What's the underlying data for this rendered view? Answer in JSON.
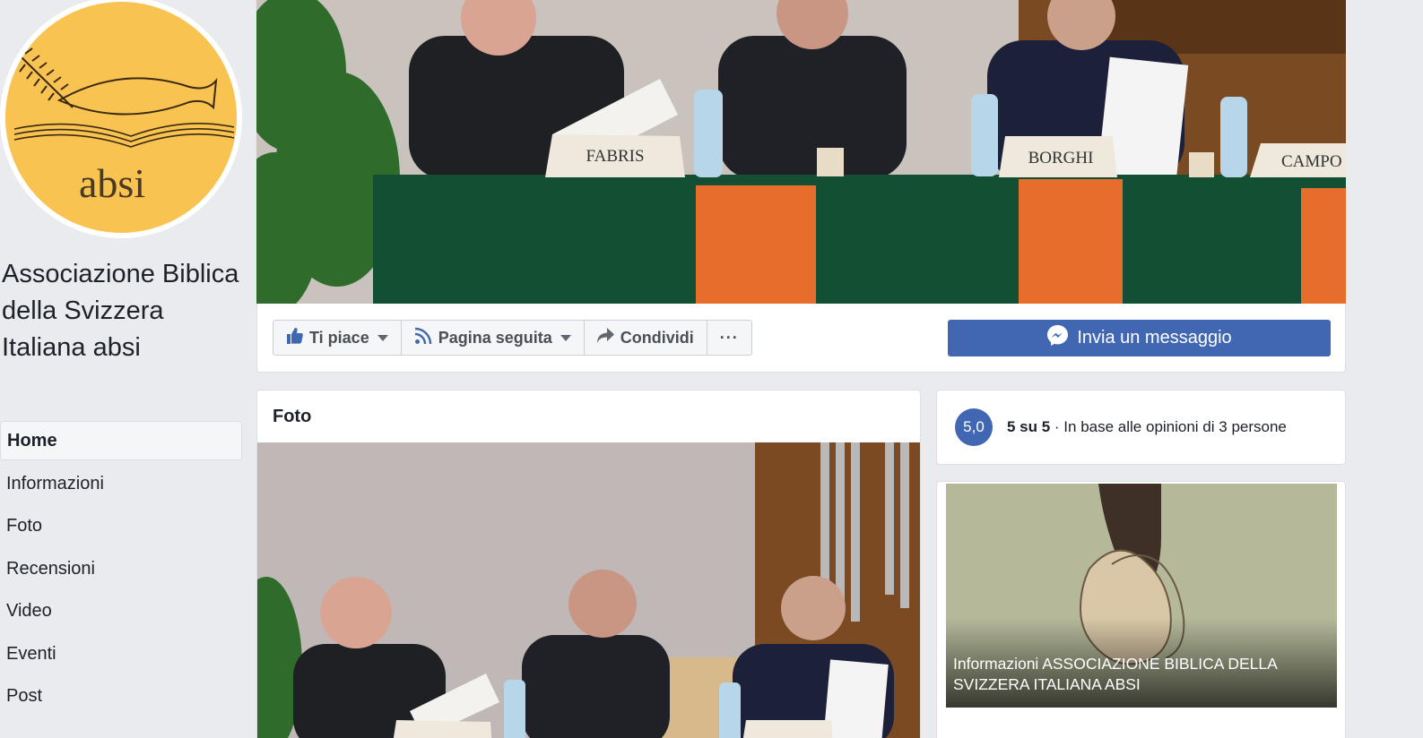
{
  "page": {
    "name": "Associazione Biblica della Svizzera Italiana absi",
    "logo_text": "absi"
  },
  "nav": {
    "items": [
      {
        "label": "Home",
        "active": true
      },
      {
        "label": "Informazioni"
      },
      {
        "label": "Foto"
      },
      {
        "label": "Recensioni"
      },
      {
        "label": "Video"
      },
      {
        "label": "Eventi"
      },
      {
        "label": "Post"
      }
    ]
  },
  "cover": {
    "nameplates": [
      "FABRIS",
      "BORGHI",
      "CAMPO"
    ]
  },
  "actions": {
    "like_label": "Ti piace",
    "follow_label": "Pagina seguita",
    "share_label": "Condividi",
    "more_label": "···",
    "message_label": "Invia un messaggio"
  },
  "photos": {
    "title": "Foto"
  },
  "rating": {
    "score": "5,0",
    "summary_bold": "5 su 5",
    "summary_rest": " · In base alle opinioni di 3 persone"
  },
  "info": {
    "caption": "Informazioni ASSOCIAZIONE BIBLICA DELLA SVIZZERA ITALIANA ABSI"
  },
  "colors": {
    "brand": "#4267b2",
    "logo_bg": "#f8c351",
    "background": "#e9ebee"
  }
}
